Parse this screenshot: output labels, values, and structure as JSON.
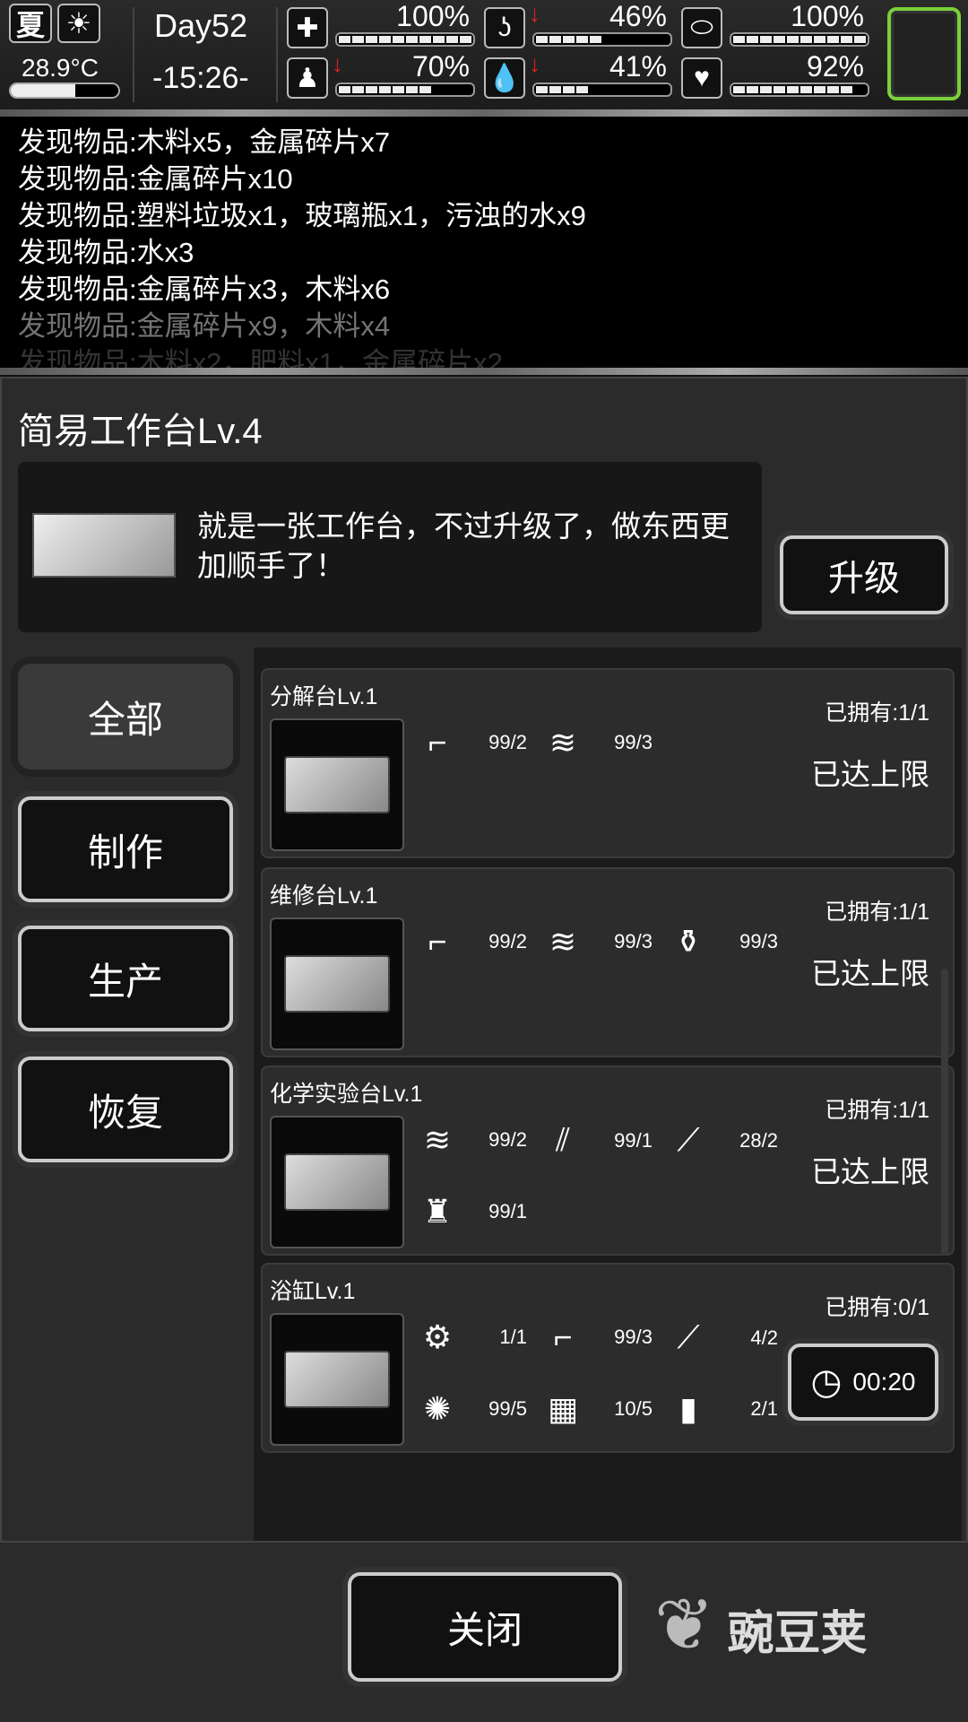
{
  "header": {
    "season": "夏",
    "weather_icon": "sun-icon",
    "temperature": "28.9°C",
    "temperature_level": 0.6,
    "day": "Day52",
    "time": "-15:26-",
    "stats": [
      {
        "name": "health",
        "icon": "first-aid-kit-icon",
        "value": "100%",
        "level": 1.0,
        "decreasing": false
      },
      {
        "name": "hunger",
        "icon": "stomach-icon",
        "value": "46%",
        "level": 0.46,
        "decreasing": true
      },
      {
        "name": "medicine",
        "icon": "pill-icon",
        "value": "100%",
        "level": 1.0,
        "decreasing": false
      },
      {
        "name": "stamina",
        "icon": "leg-icon",
        "value": "70%",
        "level": 0.7,
        "decreasing": true
      },
      {
        "name": "thirst",
        "icon": "water-drop-icon",
        "value": "41%",
        "level": 0.41,
        "decreasing": true
      },
      {
        "name": "mood",
        "icon": "heart-icon",
        "value": "92%",
        "level": 0.92,
        "decreasing": false
      }
    ],
    "accent": "#7ad03a",
    "arrow_color": "#e02020"
  },
  "log": [
    "发现物品:木料x5，金属碎片x7",
    "发现物品:金属碎片x10",
    "发现物品:塑料垃圾x1，玻璃瓶x1，污浊的水x9",
    "发现物品:水x3",
    "发现物品:金属碎片x3，木料x6",
    "发现物品:金属碎片x9，木料x4",
    "发现物品:木料x2，肥料x1，金属碎片x2"
  ],
  "panel": {
    "title": "简易工作台Lv.4",
    "description": "就是一张工作台，不过升级了，做东西更加顺手了！",
    "upgrade_label": "升级"
  },
  "tabs": [
    {
      "label": "全部",
      "active": true
    },
    {
      "label": "制作"
    },
    {
      "label": "生产"
    },
    {
      "label": "恢复"
    }
  ],
  "items": [
    {
      "name": "分解台Lv.1",
      "owned": "已拥有:1/1",
      "status": "已达上限",
      "reqs": [
        {
          "icon": "metal-scrap-icon",
          "v": "99/2"
        },
        {
          "icon": "wood-logs-icon",
          "v": "99/3"
        }
      ]
    },
    {
      "name": "维修台Lv.1",
      "owned": "已拥有:1/1",
      "status": "已达上限",
      "reqs": [
        {
          "icon": "metal-scrap-icon",
          "v": "99/2"
        },
        {
          "icon": "wood-logs-icon",
          "v": "99/3"
        },
        {
          "icon": "plastic-trash-icon",
          "v": "99/3"
        }
      ]
    },
    {
      "name": "化学实验台Lv.1",
      "owned": "已拥有:1/1",
      "status": "已达上限",
      "reqs": [
        {
          "icon": "wood-logs-icon",
          "v": "99/2"
        },
        {
          "icon": "glass-bottle-icon",
          "v": "99/1"
        },
        {
          "icon": "screw-icon",
          "v": "28/2"
        },
        {
          "icon": "spray-bottle-icon",
          "v": "99/1"
        }
      ]
    },
    {
      "name": "浴缸Lv.1",
      "owned": "已拥有:0/1",
      "timer": "00:20",
      "reqs": [
        {
          "icon": "gears-icon",
          "v": "1/1"
        },
        {
          "icon": "metal-scrap-icon",
          "v": "99/3"
        },
        {
          "icon": "pipe-icon",
          "v": "4/2"
        },
        {
          "icon": "fiber-icon",
          "v": "99/5"
        },
        {
          "icon": "bricks-icon",
          "v": "10/5"
        },
        {
          "icon": "jerry-can-icon",
          "v": "2/1"
        }
      ]
    }
  ],
  "bottom": {
    "close_label": "关闭",
    "watermark": "豌豆荚"
  }
}
